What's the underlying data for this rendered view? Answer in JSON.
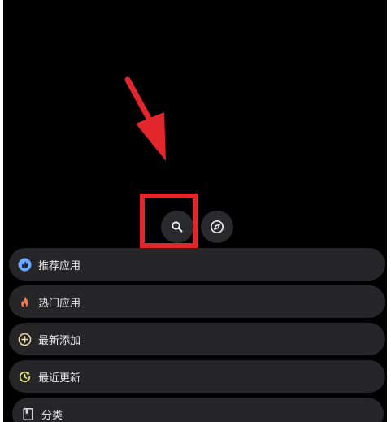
{
  "toolbar": {
    "search_icon": "search-icon",
    "explore_icon": "compass-icon"
  },
  "menu": {
    "items": [
      {
        "label": "推荐应用",
        "icon": "thumbs-up-icon",
        "color": "#6fa8ff"
      },
      {
        "label": "热门应用",
        "icon": "fire-icon",
        "color": "#f07a52"
      },
      {
        "label": "最新添加",
        "icon": "plus-circle-icon",
        "color": "#f0d9a8"
      },
      {
        "label": "最近更新",
        "icon": "refresh-icon",
        "color": "#e6ea7a"
      },
      {
        "label": "分类",
        "icon": "book-icon",
        "color": "#d8d8d8"
      }
    ]
  },
  "annotation": {
    "highlight_color": "#e3262b"
  }
}
